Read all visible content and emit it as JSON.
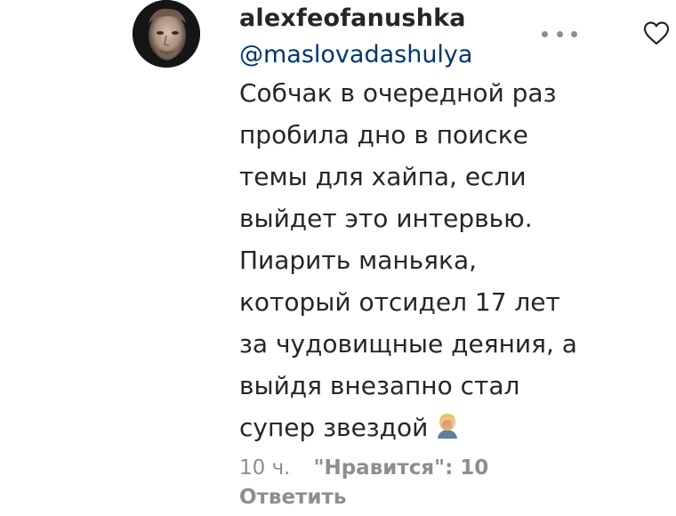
{
  "comment": {
    "username": "alexfeofanushka",
    "mention": "@maslovadashulya",
    "text_lines": [
      "Собчак в очередной раз",
      "пробила дно в поиске",
      "темы для хайпа, если",
      "выйдет это интервью.",
      "Пиарить маньяка,",
      "который отсидел 17 лет",
      "за чудовищные деяния, а",
      "выйдя внезапно стал",
      "супер звездой"
    ],
    "trailing_emoji": "face-palm-emoji",
    "time_ago": "10 ч.",
    "likes_label": "\"Нравится\": 10",
    "reply_label": "Ответить"
  },
  "icons": {
    "more": "more-options-icon",
    "like": "heart-outline-icon"
  },
  "colors": {
    "primary_text": "#262626",
    "secondary_text": "#8e8e8e",
    "mention_link": "#00376b"
  }
}
